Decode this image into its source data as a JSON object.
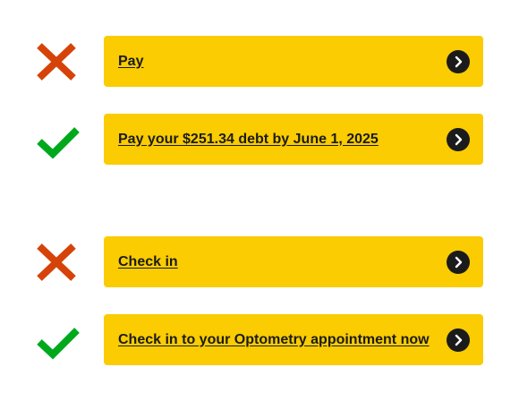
{
  "colors": {
    "action_background": "#facc01",
    "action_text": "#1b1b1b",
    "wrong_mark": "#d54309",
    "right_mark": "#00a91c",
    "chevron_circle": "#1b1b1b"
  },
  "examples": [
    {
      "mark": "wrong",
      "mark_icon": "x-icon",
      "label": "Pay",
      "chevron_icon": "chevron-right-circle-icon"
    },
    {
      "mark": "right",
      "mark_icon": "checkmark-icon",
      "label": "Pay your $251.34 debt by June 1, 2025",
      "chevron_icon": "chevron-right-circle-icon"
    },
    {
      "mark": "wrong",
      "mark_icon": "x-icon",
      "label": "Check in",
      "chevron_icon": "chevron-right-circle-icon"
    },
    {
      "mark": "right",
      "mark_icon": "checkmark-icon",
      "label": "Check in to your Optometry appointment now",
      "chevron_icon": "chevron-right-circle-icon"
    }
  ]
}
